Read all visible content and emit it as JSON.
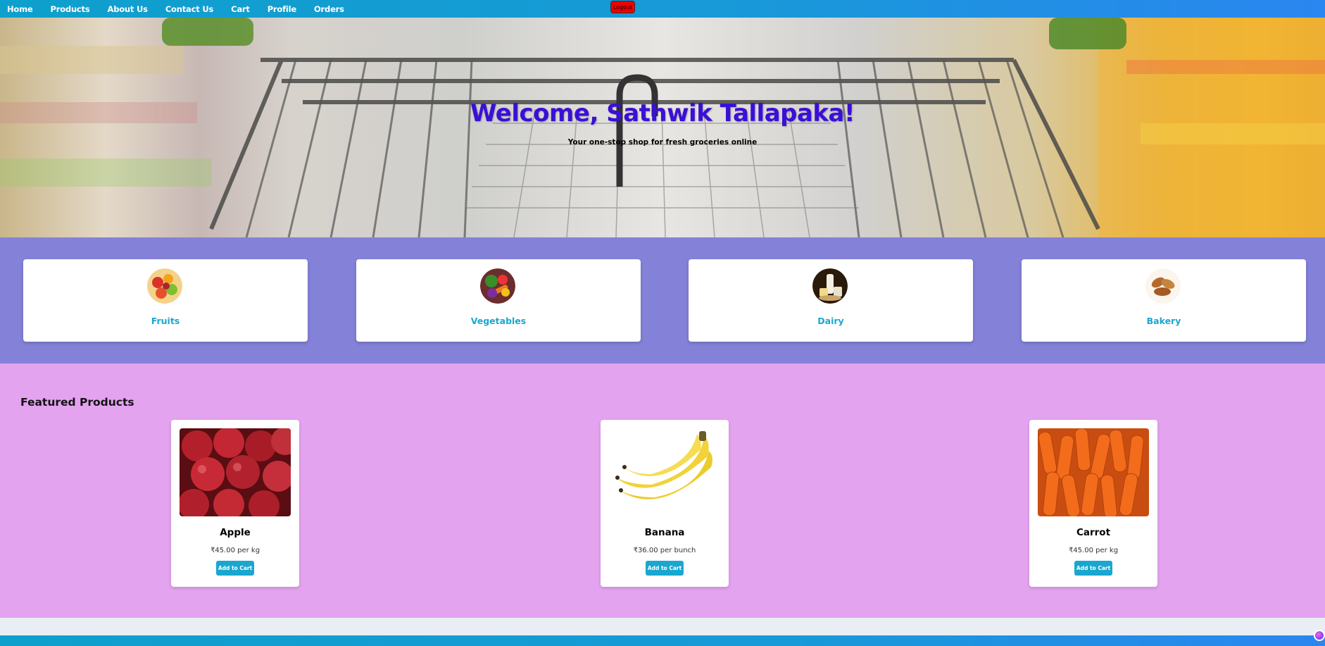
{
  "nav": {
    "links": [
      "Home",
      "Products",
      "About Us",
      "Contact Us",
      "Cart",
      "Profile",
      "Orders"
    ],
    "logout_label": "Logout"
  },
  "hero": {
    "title": "Welcome, Sathwik Tallapaka!",
    "subtitle": "Your one-stop shop for fresh groceries online"
  },
  "categories": [
    {
      "label": "Fruits",
      "icon": "fruits-icon"
    },
    {
      "label": "Vegetables",
      "icon": "vegetables-icon"
    },
    {
      "label": "Dairy",
      "icon": "dairy-icon"
    },
    {
      "label": "Bakery",
      "icon": "bakery-icon"
    }
  ],
  "featured": {
    "title": "Featured Products",
    "products": [
      {
        "name": "Apple",
        "price": "₹45.00 per kg",
        "button": "Add to Cart"
      },
      {
        "name": "Banana",
        "price": "₹36.00 per bunch",
        "button": "Add to Cart"
      },
      {
        "name": "Carrot",
        "price": "₹45.00 per kg",
        "button": "Add to Cart"
      }
    ]
  },
  "colors": {
    "nav": "#1899d8",
    "accent": "#1aa7cf",
    "hero_title": "#3a0fd6",
    "categories_bg": "#8482d8",
    "featured_bg": "#e3a3ef",
    "logout": "#ee0000"
  }
}
